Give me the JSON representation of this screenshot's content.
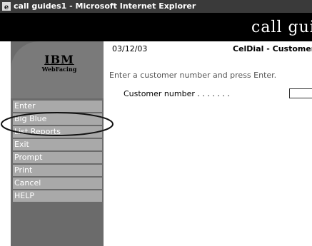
{
  "window": {
    "title": "call guides1 - Microsoft Internet Explorer",
    "icon": "internet-explorer-icon"
  },
  "banner": {
    "app_title": "call guides"
  },
  "logo": {
    "brand": "IBM",
    "product": "WebFacing"
  },
  "sidebar": {
    "items": [
      {
        "label": "Enter"
      },
      {
        "label": "Big Blue"
      },
      {
        "label": "List Reports"
      },
      {
        "label": "Exit"
      },
      {
        "label": "Prompt"
      },
      {
        "label": "Print"
      },
      {
        "label": "Cancel"
      },
      {
        "label": "HELP"
      }
    ],
    "highlighted_item": "Big Blue"
  },
  "main": {
    "date": "03/12/03",
    "system": "CelDial - Customer",
    "instruction": "Enter a customer number and press Enter.",
    "customer_number": {
      "label": "Customer number . . . . . . .",
      "value": ""
    }
  },
  "colors": {
    "title_bar": "#3a3a3a",
    "banner": "#000000",
    "sidebar": "#6b6b6b",
    "menu_item": "#a9a9a9"
  }
}
